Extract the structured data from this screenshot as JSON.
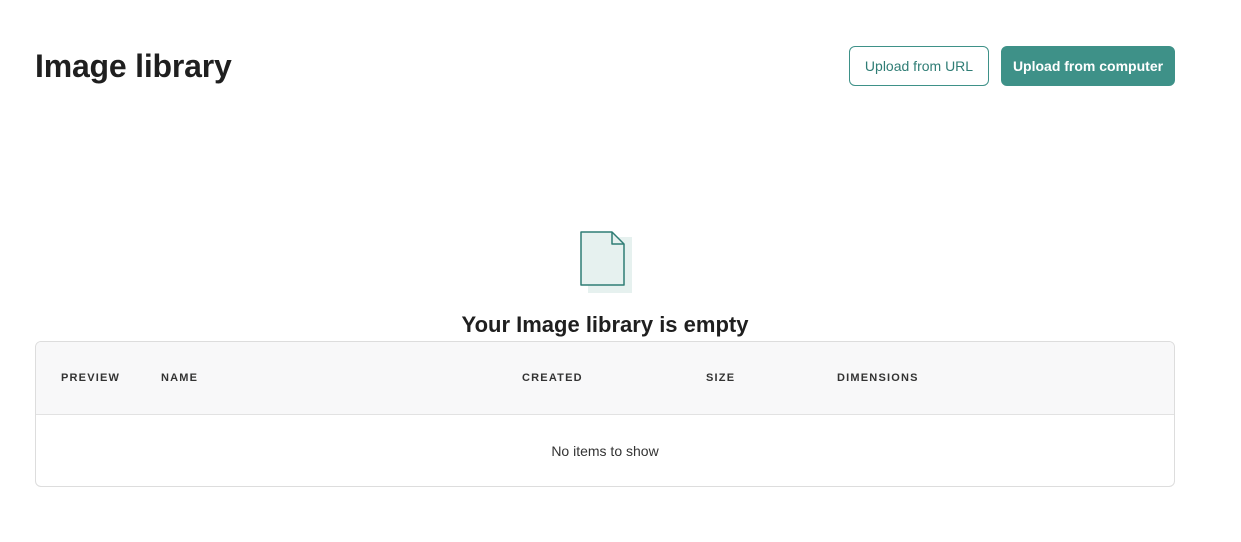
{
  "header": {
    "title": "Image library",
    "upload_url_label": "Upload from URL",
    "upload_computer_label": "Upload from computer"
  },
  "empty_state": {
    "icon": "document-icon",
    "message": "Your Image library is empty"
  },
  "table": {
    "columns": [
      "PREVIEW",
      "NAME",
      "CREATED",
      "SIZE",
      "DIMENSIONS"
    ],
    "empty_text": "No items to show"
  },
  "colors": {
    "accent": "#3e9188",
    "icon_fill": "#e6f1ef",
    "icon_stroke": "#2f7d75"
  }
}
